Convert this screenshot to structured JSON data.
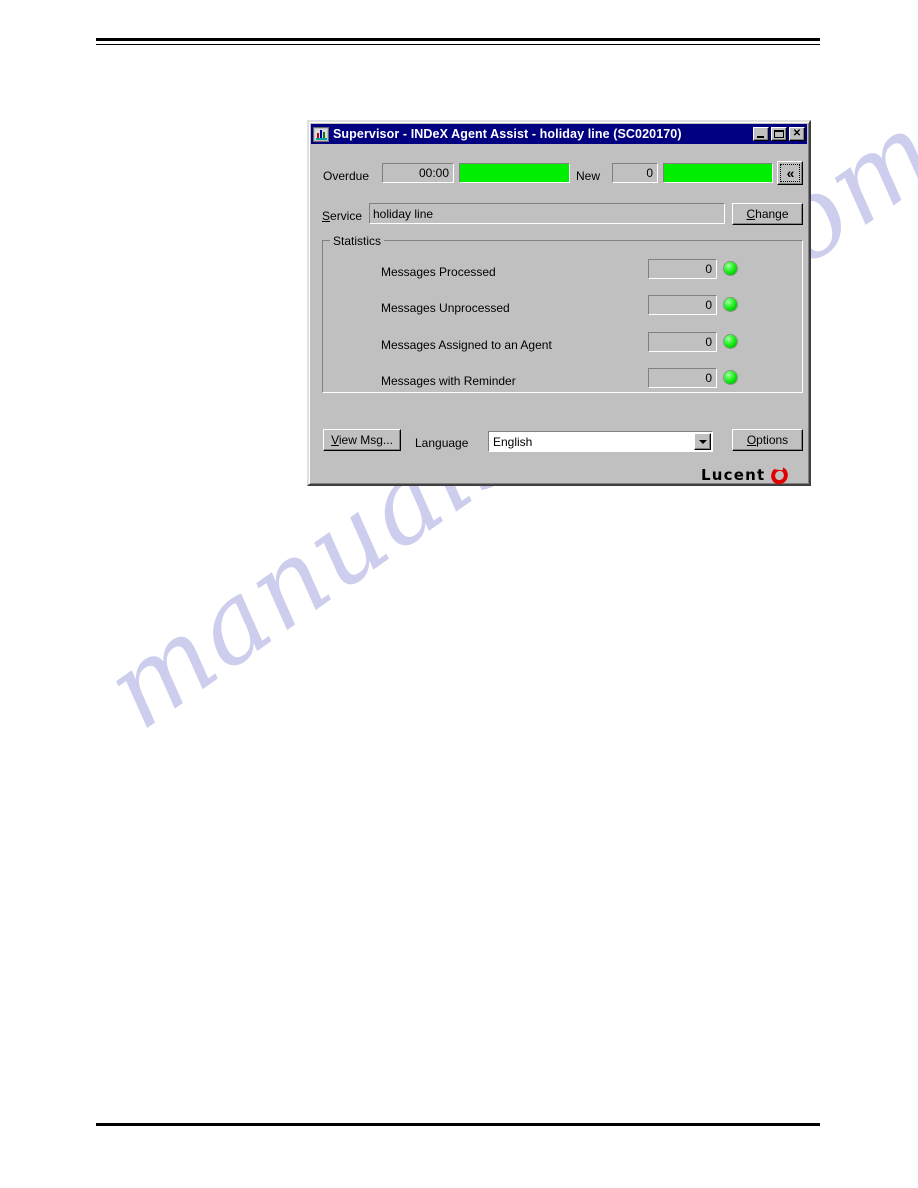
{
  "window": {
    "title": "Supervisor - INDeX Agent Assist - holiday line (SC020170)",
    "icon": "app-window-icon",
    "buttons": {
      "minimize": "minimize-icon",
      "maximize": "maximize-icon",
      "close": "✕"
    }
  },
  "status_row": {
    "overdue_label": "Overdue",
    "overdue_value": "00:00",
    "overdue_bar_color": "#00ee00",
    "new_label": "New",
    "new_value": "0",
    "new_bar_color": "#00ee00",
    "collapse_button_label": "«"
  },
  "service_row": {
    "label_prefix": "S",
    "label_rest": "ervice",
    "value": "holiday line",
    "change_button_prefix": "C",
    "change_button_rest": "hange"
  },
  "statistics": {
    "group_title": "Statistics",
    "rows": [
      {
        "label": "Messages Processed",
        "value": "0",
        "indicator": "green-led"
      },
      {
        "label": "Messages Unprocessed",
        "value": "0",
        "indicator": "green-led"
      },
      {
        "label": "Messages Assigned to an Agent",
        "value": "0",
        "indicator": "green-led"
      },
      {
        "label": "Messages with Reminder",
        "value": "0",
        "indicator": "green-led"
      }
    ]
  },
  "footer": {
    "view_msg_prefix": "V",
    "view_msg_rest": "iew Msg...",
    "language_label": "Language",
    "language_value": "English",
    "options_prefix": "O",
    "options_rest": "ptions",
    "brand_word": "Lucent",
    "brand_mark_color": "#e00000"
  },
  "page": {
    "watermark": "manualshive.com",
    "watermark_color": "#c9c9ec"
  }
}
